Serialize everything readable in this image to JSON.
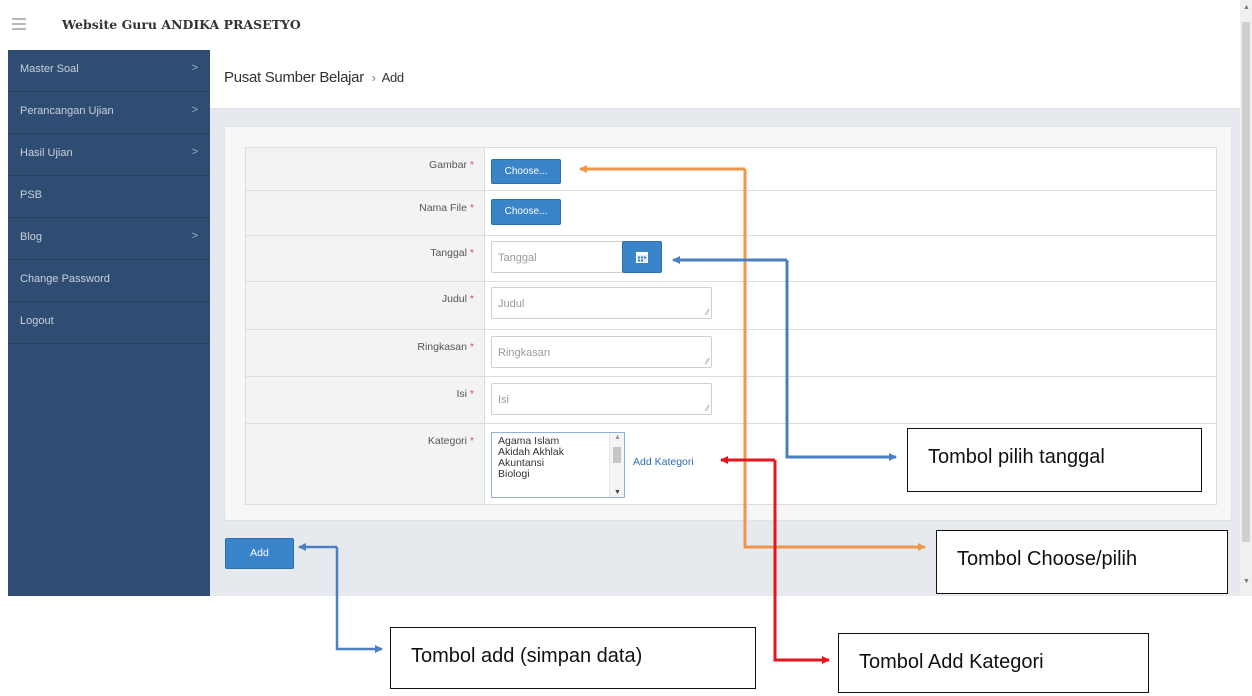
{
  "app": {
    "title": "Website Guru ANDIKA PRASETYO"
  },
  "sidebar": {
    "items": [
      {
        "label": "Master Soal",
        "chevron": ">"
      },
      {
        "label": "Perancangan Ujian",
        "chevron": ">"
      },
      {
        "label": "Hasil Ujian",
        "chevron": ">"
      },
      {
        "label": "PSB",
        "chevron": ""
      },
      {
        "label": "Blog",
        "chevron": ">"
      },
      {
        "label": "Change Password",
        "chevron": ""
      },
      {
        "label": "Logout",
        "chevron": ""
      }
    ]
  },
  "breadcrumb": {
    "section": "Pusat Sumber Belajar",
    "separator": "›",
    "current": "Add"
  },
  "form": {
    "required_mark": "*",
    "gambar": {
      "label": "Gambar",
      "button": "Choose..."
    },
    "nama_file": {
      "label": "Nama File",
      "button": "Choose..."
    },
    "tanggal": {
      "label": "Tanggal",
      "placeholder": "Tanggal",
      "button_icon": "calendar-icon"
    },
    "judul": {
      "label": "Judul",
      "placeholder": "Judul"
    },
    "ringkasan": {
      "label": "Ringkasan",
      "placeholder": "Ringkasan"
    },
    "isi": {
      "label": "Isi",
      "placeholder": "Isi"
    },
    "kategori": {
      "label": "Kategori",
      "options": [
        "Agama Islam",
        "Akidah Akhlak",
        "Akuntansi",
        "Biologi"
      ],
      "add_link": "Add Kategori"
    },
    "submit": "Add"
  },
  "annotations": {
    "tanggal": "Tombol pilih tanggal",
    "choose": "Tombol Choose/pilih",
    "add": "Tombol add (simpan data)",
    "kategori": "Tombol Add Kategori"
  },
  "colors": {
    "sidebar": "#2f4d72",
    "primary_button": "#3a84c9",
    "arrow_orange": "#f0964a",
    "arrow_blue": "#4a7fc1",
    "arrow_red": "#e8141b"
  }
}
